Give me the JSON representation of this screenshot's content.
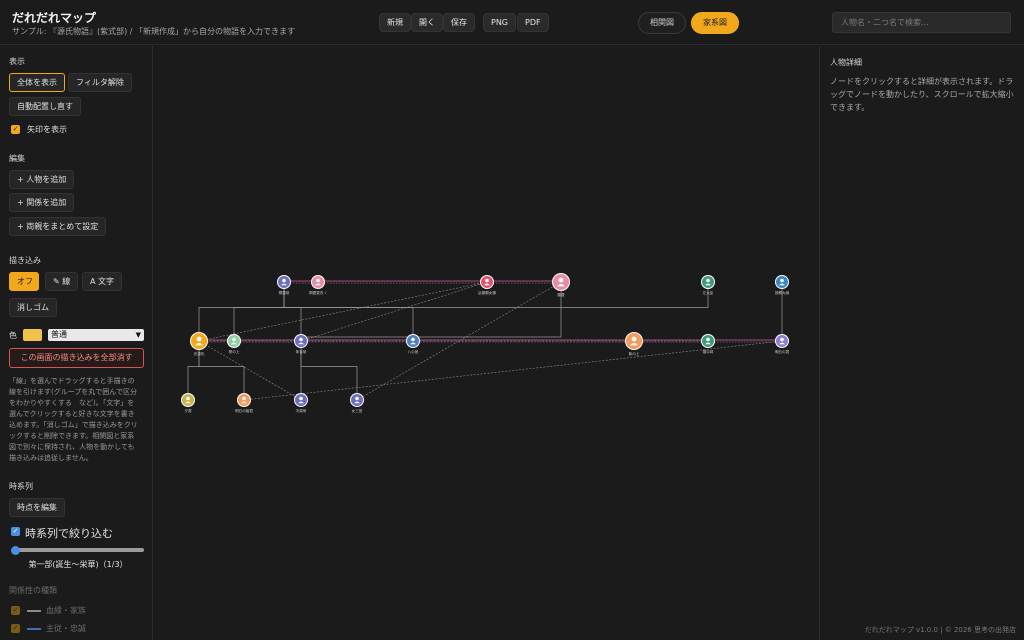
{
  "header": {
    "title": "だれだれマップ",
    "subtitle": "サンプル: 『源氏物語』(紫式部) / 「新規作成」から自分の物語を入力できます",
    "buttons": {
      "new": "新規",
      "open": "開く",
      "save": "保存",
      "png": "PNG",
      "pdf": "PDF"
    },
    "views": {
      "correlation": "相関図",
      "family": "家系図"
    },
    "active_view": "家系図",
    "search_placeholder": "人物名・二つ名で検索..."
  },
  "sidebar": {
    "display": {
      "heading": "表示",
      "show_all": "全体を表示",
      "clear_filter": "フィルタ解除",
      "auto_layout": "自動配置し直す",
      "show_arrows": "矢印を表示",
      "show_arrows_checked": true
    },
    "edit": {
      "heading": "編集",
      "add_person": "+ 人物を追加",
      "add_relation": "+ 関係を追加",
      "set_parents": "+ 両親をまとめて設定"
    },
    "drawing": {
      "heading": "描き込み",
      "off": "オフ",
      "line": "✎ 線",
      "text": "A 文字",
      "eraser": "消しゴム",
      "color_label": "色",
      "color": "#f1c24a",
      "width_option": "普通",
      "clear_all": "この画面の描き込みを全部消す",
      "help": "「線」を選んでドラッグすると手描きの線を引けます(グループを丸で囲んで区分をわかりやすくする　など)。「文字」を選んでクリックすると好きな文字を書き込めます。「消しゴム」で描き込みをクリックすると削除できます。相関図と家系図で別々に保持され、人物を動かしても描き込みは追従しません。"
    },
    "timeline": {
      "heading": "時系列",
      "edit_points": "時点を編集",
      "filter_label": "時系列で絞り込む",
      "filter_checked": true,
      "position": 0,
      "current": "第一部(誕生〜栄華)（1/3）"
    },
    "relation_types": {
      "heading": "関係性の種類",
      "items": [
        {
          "label": "血縁・家族",
          "color": "#8a8a8a"
        },
        {
          "label": "主従・忠誠",
          "color": "#3f6fb0"
        }
      ]
    }
  },
  "detail": {
    "title": "人物詳細",
    "text": "ノードをクリックすると詳細が表示されます。ドラッグでノードを動かしたり、スクロールで拡大縮小できます。"
  },
  "footer": "だれだれマップ v1.0.0  |  © 2026 思考の出発店",
  "colors": {
    "accent": "#f3a81c",
    "marriage": "#e0569a",
    "lineage": "#9a9a9a"
  },
  "tree": {
    "nodes": [
      {
        "id": "n1",
        "label": "桐壺帝",
        "color": "#6b6fc0"
      },
      {
        "id": "n2",
        "label": "桐壺更衣 ♪",
        "color": "#e98da6"
      },
      {
        "id": "n3",
        "label": "弘徽殿女御",
        "color": "#e0566e"
      },
      {
        "id": "n4",
        "label": "藤壺",
        "color": "#e98da6"
      },
      {
        "id": "n5",
        "label": "左大臣",
        "color": "#3f9c7a"
      },
      {
        "id": "n6",
        "label": "按察大納",
        "color": "#3a86c8"
      },
      {
        "id": "n7",
        "label": "光源氏",
        "color": "#f3a81c"
      },
      {
        "id": "n8",
        "label": "葵の上",
        "color": "#8fd0a0"
      },
      {
        "id": "n9",
        "label": "朱雀帝",
        "color": "#6b6fc0"
      },
      {
        "id": "n10",
        "label": "八の宮",
        "color": "#4d7fc0"
      },
      {
        "id": "n11",
        "label": "紫の上",
        "color": "#f39a5c"
      },
      {
        "id": "n12",
        "label": "頭中将",
        "color": "#3f9c7a"
      },
      {
        "id": "n13",
        "label": "明石の君",
        "color": "#8e7fd0"
      },
      {
        "id": "n14",
        "label": "夕霧",
        "color": "#c9b34a"
      },
      {
        "id": "n15",
        "label": "明石の姫君",
        "color": "#f39a5c"
      },
      {
        "id": "n16",
        "label": "冷泉帝",
        "color": "#6b6fc0"
      },
      {
        "id": "n17",
        "label": "女三宮",
        "color": "#6b6fc0"
      }
    ],
    "marriages": [
      [
        "n1",
        "n2"
      ],
      [
        "n2",
        "n3"
      ],
      [
        "n3",
        "n4"
      ],
      [
        "n7",
        "n8"
      ],
      [
        "n8",
        "n11"
      ],
      [
        "n11",
        "n12"
      ],
      [
        "n12",
        "n13"
      ]
    ],
    "parent_links": [
      [
        "n1",
        "n7"
      ],
      [
        "n1",
        "n9"
      ],
      [
        "n1",
        "n10"
      ],
      [
        "n5",
        "n8"
      ],
      [
        "n6",
        "n13"
      ],
      [
        "n7",
        "n14"
      ],
      [
        "n7",
        "n15"
      ],
      [
        "n4",
        "n16"
      ],
      [
        "n9",
        "n17"
      ]
    ],
    "relation_links": [
      [
        "n7",
        "n3"
      ],
      [
        "n9",
        "n3"
      ],
      [
        "n7",
        "n12"
      ],
      [
        "n15",
        "n13"
      ],
      [
        "n17",
        "n4"
      ],
      [
        "n7",
        "n16"
      ]
    ]
  }
}
